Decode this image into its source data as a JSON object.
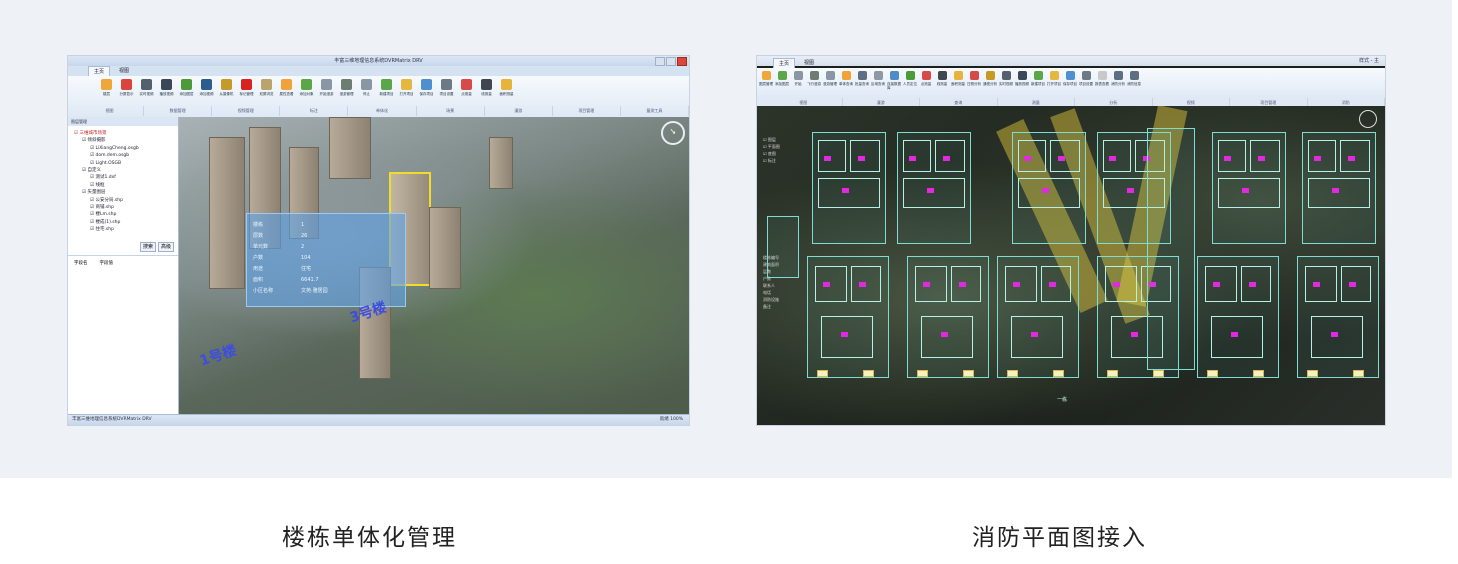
{
  "captions": {
    "left": "楼栋单体化管理",
    "right": "消防平面图接入"
  },
  "left_app": {
    "window_title": "丰富三维地理信息系统DVRMatrix DRV",
    "tabs": [
      "主页",
      "视图"
    ],
    "ribbon_buttons": [
      {
        "label": "楼层",
        "icon": "layers-icon",
        "color": "#f0a73a"
      },
      {
        "label": "分屏显示",
        "icon": "split-icon",
        "color": "#d9453b"
      },
      {
        "label": "实时视频",
        "icon": "camera-icon",
        "color": "#55606f"
      },
      {
        "label": "播放视频",
        "icon": "film-icon",
        "color": "#3a4756"
      },
      {
        "label": "添加图层",
        "icon": "globe-icon",
        "color": "#4c9a3a"
      },
      {
        "label": "添加视频",
        "icon": "book-icon",
        "color": "#2d5c8e"
      },
      {
        "label": "从摄像机",
        "icon": "tool-icon",
        "color": "#c49a29"
      },
      {
        "label": "标记管理",
        "icon": "pin-icon",
        "color": "#d9231f"
      },
      {
        "label": "双屏浏览",
        "icon": "image-icon",
        "color": "#b9a56c"
      },
      {
        "label": "属性查看",
        "icon": "info-icon",
        "color": "#f2a23a"
      },
      {
        "label": "添加对象",
        "icon": "plus-icon",
        "color": "#5aa648"
      },
      {
        "label": "开始漫游",
        "icon": "road-icon",
        "color": "#8a96a4"
      },
      {
        "label": "漫游管理",
        "icon": "walk-icon",
        "color": "#6d7d73"
      },
      {
        "label": "停止",
        "icon": "stop-icon",
        "color": "#8a96a4"
      },
      {
        "label": "新建项目",
        "icon": "add-icon",
        "color": "#5aa648"
      },
      {
        "label": "打开项目",
        "icon": "folder-icon",
        "color": "#e5b640"
      },
      {
        "label": "保存项目",
        "icon": "save-icon",
        "color": "#4f8fcf"
      },
      {
        "label": "项目设置",
        "icon": "minus-icon",
        "color": "#6c7a86"
      },
      {
        "label": "点测量",
        "icon": "location-icon",
        "color": "#d64a49"
      },
      {
        "label": "线测量",
        "icon": "ruler-icon",
        "color": "#3f4650"
      },
      {
        "label": "面积测量",
        "icon": "area-icon",
        "color": "#e6b33c"
      }
    ],
    "ribbon_groups": [
      "视图",
      "数据管理",
      "视频管理",
      "标注",
      "单体化",
      "场景",
      "漫游",
      "项目管理",
      "量测工具"
    ],
    "side_panel_title": "图层管理",
    "tree": [
      {
        "level": 1,
        "text": "☑ 三维城市场景",
        "red": true
      },
      {
        "level": 2,
        "text": "☑ 倾斜摄影",
        "red": false
      },
      {
        "level": 3,
        "text": "☑ LiXiangCheng.osgb",
        "red": false
      },
      {
        "level": 3,
        "text": "☑ dom.dem.osgb",
        "red": false
      },
      {
        "level": 3,
        "text": "☑ Light.OSGB",
        "red": false
      },
      {
        "level": 2,
        "text": "☑ 自定义",
        "red": false
      },
      {
        "level": 3,
        "text": "☑ 测试1.dxf",
        "red": false
      },
      {
        "level": 3,
        "text": "☑ 线框",
        "red": false
      },
      {
        "level": 2,
        "text": "☑ 矢量图层",
        "red": false
      },
      {
        "level": 3,
        "text": "☑ 公安分局.shp",
        "red": false
      },
      {
        "level": 3,
        "text": "☑ 商铺.shp",
        "red": false
      },
      {
        "level": 3,
        "text": "☑ 楼Lm.shp",
        "red": false
      },
      {
        "level": 3,
        "text": "☑ 楼成(1).shp",
        "red": false
      },
      {
        "level": 3,
        "text": "☑ 住宅.shp",
        "red": false
      }
    ],
    "side_buttons": [
      "搜索",
      "高级"
    ],
    "prop_columns": [
      "字段名",
      "字段值"
    ],
    "popup_rows": [
      {
        "k": "楼栋",
        "v": "1"
      },
      {
        "k": "层数",
        "v": "26"
      },
      {
        "k": "单元数",
        "v": "2"
      },
      {
        "k": "户数",
        "v": "104"
      },
      {
        "k": "用途",
        "v": "住宅"
      },
      {
        "k": "面积",
        "v": "6641.7"
      },
      {
        "k": "小区名称",
        "v": "文苑·雅居园"
      }
    ],
    "scene_labels": [
      "1号楼",
      "3号楼"
    ],
    "compass_symbol": "➘",
    "status_left": "丰富三维地理信息系统DVRMatrix DRV",
    "status_right": "就绪 100%"
  },
  "right_app": {
    "window_title": "样式 - 主",
    "tabs": [
      "主页",
      "视图"
    ],
    "ribbon_buttons": [
      {
        "label": "图层管理",
        "icon": "layers-icon",
        "color": "#f0a73a"
      },
      {
        "label": "添加图层",
        "icon": "add-icon",
        "color": "#5aa648"
      },
      {
        "label": "开始",
        "icon": "road-icon",
        "color": "#8a96a4"
      },
      {
        "label": "飞行漫游",
        "icon": "walk-icon",
        "color": "#6d7d73"
      },
      {
        "label": "漫游管理",
        "icon": "road-icon",
        "color": "#8a96a4"
      },
      {
        "label": "单体查询",
        "icon": "info-icon",
        "color": "#f2a23a"
      },
      {
        "label": "批量查询",
        "icon": "arrow-icon",
        "color": "#5f6f82"
      },
      {
        "label": "区域查询",
        "icon": "grid-icon",
        "color": "#8f99a6"
      },
      {
        "label": "连接数据库",
        "icon": "person-icon",
        "color": "#4e8cc8"
      },
      {
        "label": "人员定位",
        "icon": "globe-icon",
        "color": "#4c9a3a"
      },
      {
        "label": "点测量",
        "icon": "location-icon",
        "color": "#d64a49"
      },
      {
        "label": "线测量",
        "icon": "ruler-icon",
        "color": "#3f4650"
      },
      {
        "label": "面积测量",
        "icon": "area-icon",
        "color": "#e6b33c"
      },
      {
        "label": "日照分析",
        "icon": "location-icon",
        "color": "#d64a49"
      },
      {
        "label": "通视分析",
        "icon": "tool-icon",
        "color": "#c49a29"
      },
      {
        "label": "实时视频",
        "icon": "camera-icon",
        "color": "#55606f"
      },
      {
        "label": "播放视频",
        "icon": "film-icon",
        "color": "#3a4756"
      },
      {
        "label": "新建项目",
        "icon": "plus-icon",
        "color": "#5aa648"
      },
      {
        "label": "打开项目",
        "icon": "folder-icon",
        "color": "#e5b640"
      },
      {
        "label": "保存项目",
        "icon": "save-icon",
        "color": "#4f8fcf"
      },
      {
        "label": "项目设置",
        "icon": "minus-icon",
        "color": "#6c7a86"
      },
      {
        "label": "报表查看",
        "icon": "doc-icon",
        "color": "#c9c9c9"
      },
      {
        "label": "消防分析",
        "icon": "arrow-icon",
        "color": "#5f6f82"
      },
      {
        "label": "消防信息",
        "icon": "arrow-icon",
        "color": "#5f6f82"
      }
    ],
    "ribbon_groups": [
      "视图",
      "漫游",
      "查询",
      "测量",
      "分析",
      "视频",
      "项目管理",
      "消防"
    ],
    "legend_rows": [
      "☑ 图层",
      "☑ 平面图",
      "☑ 底图",
      "☑ 标注"
    ],
    "info_rows": [
      "楼栋编号",
      "建筑面积",
      "层数",
      "户数",
      "联系人",
      "电话",
      "消防设施",
      "备注"
    ],
    "map_label": "一栋"
  }
}
